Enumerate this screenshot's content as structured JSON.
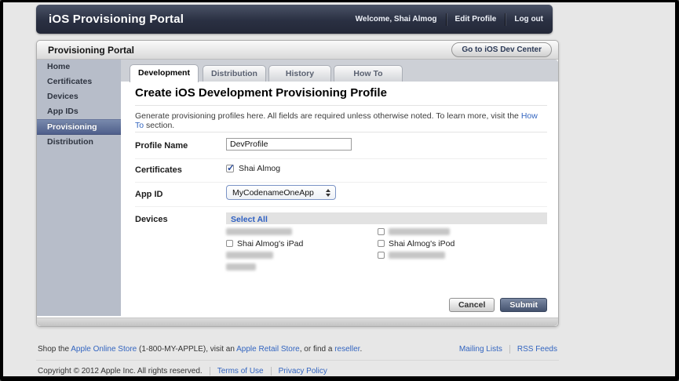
{
  "colors": {
    "link_blue": "#3365c0",
    "header_navy": "#2a3042",
    "sidebar_selected": "#5f6f94",
    "submit_slate": "#44526e"
  },
  "header": {
    "title": "iOS Provisioning Portal",
    "welcome": "Welcome, Shai Almog",
    "edit_profile": "Edit Profile",
    "log_out": "Log out"
  },
  "portal_bar": {
    "title": "Provisioning Portal",
    "dev_center_button": "Go to iOS Dev Center"
  },
  "sidebar": {
    "items": [
      {
        "label": "Home",
        "active": false
      },
      {
        "label": "Certificates",
        "active": false
      },
      {
        "label": "Devices",
        "active": false
      },
      {
        "label": "App IDs",
        "active": false
      },
      {
        "label": "Provisioning",
        "active": true
      },
      {
        "label": "Distribution",
        "active": false
      }
    ]
  },
  "tabs": [
    {
      "label": "Development",
      "active": true
    },
    {
      "label": "Distribution",
      "active": false
    },
    {
      "label": "History",
      "active": false
    },
    {
      "label": "How To",
      "active": false
    }
  ],
  "content": {
    "title": "Create iOS Development Provisioning Profile",
    "intro_prefix": "Generate provisioning profiles here. All fields are required unless otherwise noted. To learn more, visit the ",
    "intro_link": "How To",
    "intro_suffix": " section.",
    "form": {
      "profile_name_label": "Profile Name",
      "profile_name_value": "DevProfile",
      "certificates_label": "Certificates",
      "certificate_option": "Shai Almog",
      "certificate_checked": true,
      "app_id_label": "App ID",
      "app_id_value": "MyCodenameOneApp",
      "devices_label": "Devices",
      "select_all_label": "Select All",
      "device_columns": [
        [
          {
            "redacted": true,
            "checkbox": false,
            "blur_width": 84
          },
          {
            "label": "Shai Almog's iPad",
            "checkbox": true,
            "redacted": false
          },
          {
            "redacted": true,
            "checkbox": false,
            "blur_width": 60
          },
          {
            "redacted": true,
            "checkbox": false,
            "blur_width": 38
          }
        ],
        [
          {
            "redacted": true,
            "checkbox": true,
            "blur_width": 78
          },
          {
            "label": "Shai Almog's iPod",
            "checkbox": true,
            "redacted": false
          },
          {
            "redacted": true,
            "checkbox": true,
            "blur_width": 72
          }
        ]
      ]
    },
    "buttons": {
      "cancel": "Cancel",
      "submit": "Submit"
    }
  },
  "footer": {
    "shop_prefix": "Shop the ",
    "store_link": "Apple Online Store",
    "shop_mid1": " (1-800-MY-APPLE), visit an ",
    "retail_link": "Apple Retail Store",
    "shop_mid2": ", or find a ",
    "reseller_link": "reseller",
    "shop_suffix": ".",
    "mailing_lists": "Mailing Lists",
    "rss_feeds": "RSS Feeds",
    "copyright": "Copyright © 2012 Apple Inc. All rights reserved.",
    "terms": "Terms of Use",
    "privacy": "Privacy Policy"
  }
}
